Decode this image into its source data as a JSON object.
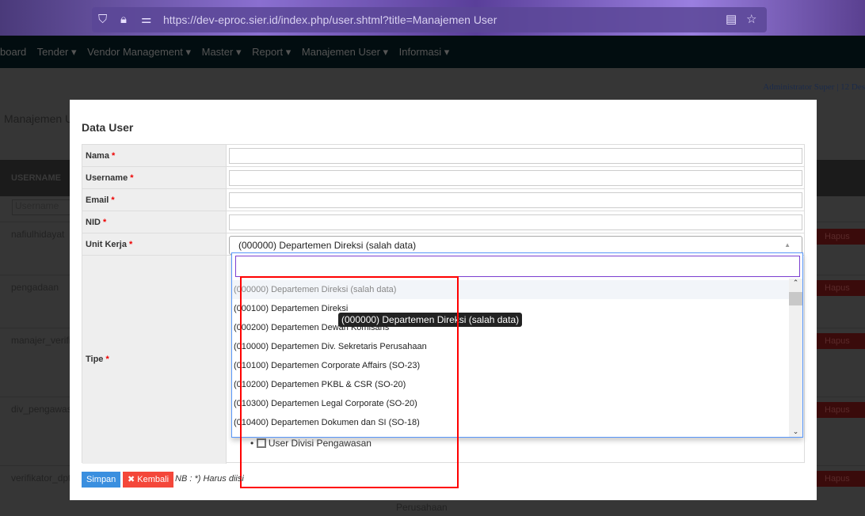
{
  "browser": {
    "url": "https://dev-eproc.sier.id/index.php/user.shtml?title=Manajemen User"
  },
  "nav": [
    "board",
    "Tender ▾",
    "Vendor Management ▾",
    "Master ▾",
    "Report ▾",
    "Manajemen User ▾",
    "Informasi ▾"
  ],
  "header": {
    "user": "Administrator Super",
    "date": "12 Des"
  },
  "background": {
    "page_title": "Manajemen Us",
    "col_username": "USERNAME",
    "filter_placeholder": "Username",
    "rows": [
      "nafiulhidayat",
      "pengadaan",
      "manajer_verifik",
      "div_pengawasa",
      "verifikator_dpt"
    ],
    "delete_label": "Hapus",
    "extra_cell": "Perusahaan"
  },
  "modal": {
    "title": "Data User",
    "fields": [
      {
        "label": "Nama"
      },
      {
        "label": "Username"
      },
      {
        "label": "Email"
      },
      {
        "label": "NID"
      },
      {
        "label": "Unit Kerja"
      },
      {
        "label": "Tipe"
      }
    ],
    "required_mark": "*",
    "unit_kerja_selected": "(000000) Departemen Direksi (salah data)",
    "tooltip": "(000000) Departemen Direksi (salah data)",
    "options": [
      "(000000) Departemen Direksi (salah data)",
      "(000100) Departemen Direksi",
      "(000200) Departemen Dewan Komisaris",
      "(010000) Departemen Div. Sekretaris Perusahaan",
      "(010100) Departemen Corporate Affairs (SO-23)",
      "(010200) Departemen PKBL & CSR (SO-20)",
      "(010300) Departemen Legal Corporate (SO-20)",
      "(010400) Departemen Dokumen dan SI (SO-18)"
    ],
    "tipe_checkbox": "User Divisi Pengawasan",
    "save": "Simpan",
    "back": "Kembali",
    "note": "NB : *) Harus diisi"
  }
}
